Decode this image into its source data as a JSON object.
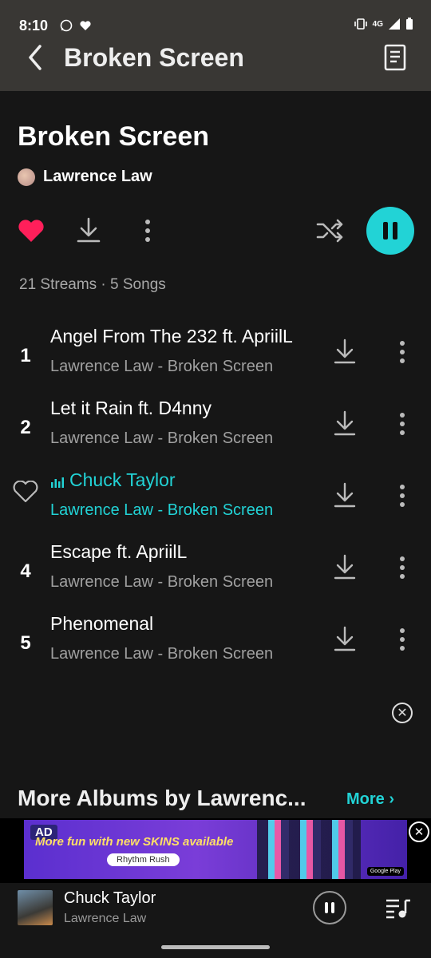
{
  "status_bar": {
    "time": "8:10",
    "network": "4G"
  },
  "header": {
    "title": "Broken Screen"
  },
  "album": {
    "title": "Broken Screen",
    "artist": "Lawrence Law",
    "stats": "21 Streams · 5 Songs"
  },
  "tracks": [
    {
      "number": "1",
      "title": "Angel From The 232 ft. ApriilL",
      "artist": "Lawrence Law",
      "separator": "-",
      "album": "Broken Screen",
      "active": false
    },
    {
      "number": "2",
      "title": "Let it Rain ft. D4nny",
      "artist": "Lawrence Law",
      "separator": "-",
      "album": "Broken Screen",
      "active": false
    },
    {
      "number": "",
      "title": "Chuck Taylor",
      "artist": "Lawrence Law",
      "separator": "-",
      "album": "Broken Screen",
      "active": true
    },
    {
      "number": "4",
      "title": "Escape ft. ApriilL",
      "artist": "Lawrence Law",
      "separator": "-",
      "album": "Broken Screen",
      "active": false
    },
    {
      "number": "5",
      "title": "Phenomenal",
      "artist": "Lawrence Law",
      "separator": "-",
      "album": "Broken Screen",
      "active": false
    }
  ],
  "more_albums": {
    "heading": "More Albums by Lawrenc...",
    "link": "More"
  },
  "ad": {
    "label": "AD",
    "headline": "More fun with new SKINS available",
    "app_name": "Rhythm Rush",
    "store_badge": "Google Play"
  },
  "mini_player": {
    "title": "Chuck Taylor",
    "artist": "Lawrence Law"
  },
  "colors": {
    "accent": "#22d3d6",
    "heart": "#ff1f5a",
    "background": "#161616",
    "header": "#393734"
  }
}
